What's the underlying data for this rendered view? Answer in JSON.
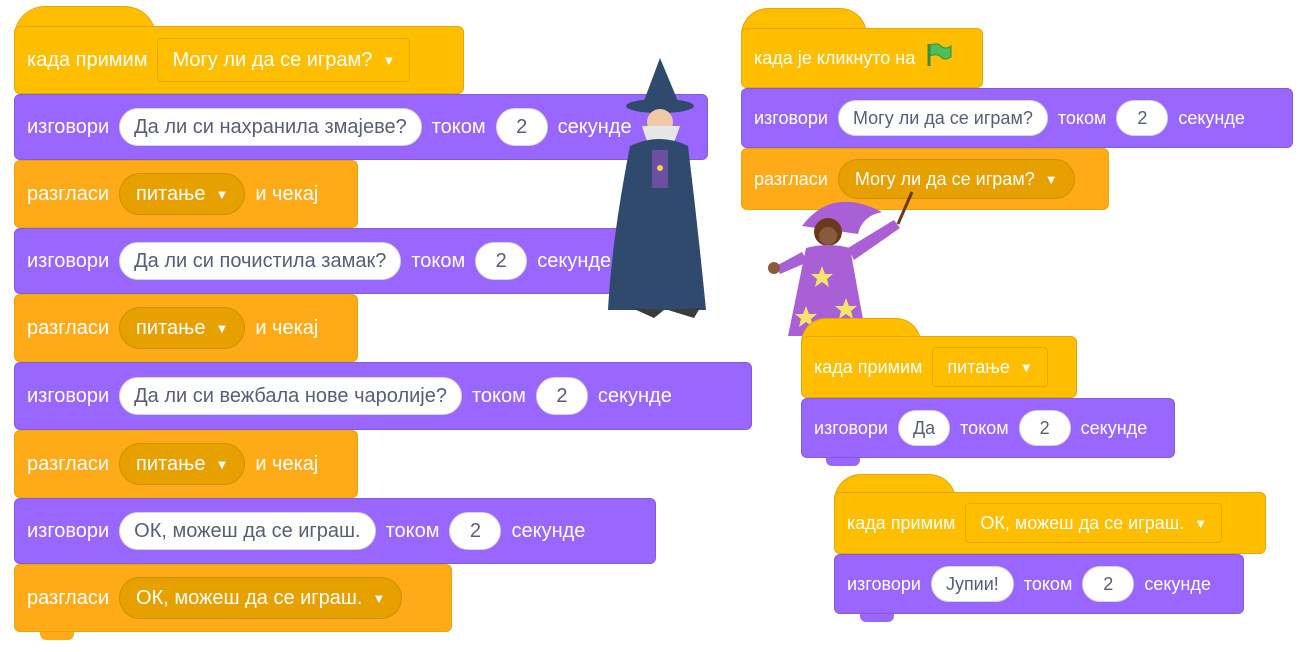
{
  "left_script": {
    "hat": {
      "label": "када примим",
      "message": "Могу ли да се играм?"
    },
    "blocks": [
      {
        "kind": "say",
        "label": "изговори",
        "text": "Да ли си нахранила змајеве?",
        "for_label": "током",
        "secs": "2",
        "secs_label": "секунде"
      },
      {
        "kind": "broadcast",
        "label": "разгласи",
        "message": "питање",
        "suffix": "и чекај"
      },
      {
        "kind": "say",
        "label": "изговори",
        "text": "Да ли си почистила замак?",
        "for_label": "током",
        "secs": "2",
        "secs_label": "секунде"
      },
      {
        "kind": "broadcast",
        "label": "разгласи",
        "message": "питање",
        "suffix": "и чекај"
      },
      {
        "kind": "say",
        "label": "изговори",
        "text": "Да ли си вежбала нове чаролије?",
        "for_label": "током",
        "secs": "2",
        "secs_label": "секунде"
      },
      {
        "kind": "broadcast",
        "label": "разгласи",
        "message": "питање",
        "suffix": "и чекај"
      },
      {
        "kind": "say",
        "label": "изговори",
        "text": "ОК, можеш да се играш.",
        "for_label": "током",
        "secs": "2",
        "secs_label": "секунде"
      },
      {
        "kind": "broadcast",
        "label": "разгласи",
        "message": "ОК, можеш да се играш."
      }
    ]
  },
  "right_script_1": {
    "hat": {
      "label": "када је кликнуто на",
      "icon": "green-flag-icon"
    },
    "say": {
      "label": "изговори",
      "text": "Могу ли да се играм?",
      "for_label": "током",
      "secs": "2",
      "secs_label": "секунде"
    },
    "broadcast": {
      "label": "разгласи",
      "message": "Могу ли да се играм?"
    }
  },
  "right_script_2": {
    "hat": {
      "label": "када примим",
      "message": "питање"
    },
    "say": {
      "label": "изговори",
      "text": "Да",
      "for_label": "током",
      "secs": "2",
      "secs_label": "секунде"
    }
  },
  "right_script_3": {
    "hat": {
      "label": "када примим",
      "message": "ОК, можеш да се играш."
    },
    "say": {
      "label": "изговори",
      "text": "Јупии!",
      "for_label": "током",
      "secs": "2",
      "secs_label": "секунде"
    }
  },
  "sprites": {
    "wizard": "wizard-sprite",
    "girl": "girl-wizard-sprite"
  },
  "colors": {
    "events": "#ffbf00",
    "looks": "#9966ff",
    "flag": "#4cbf56"
  }
}
